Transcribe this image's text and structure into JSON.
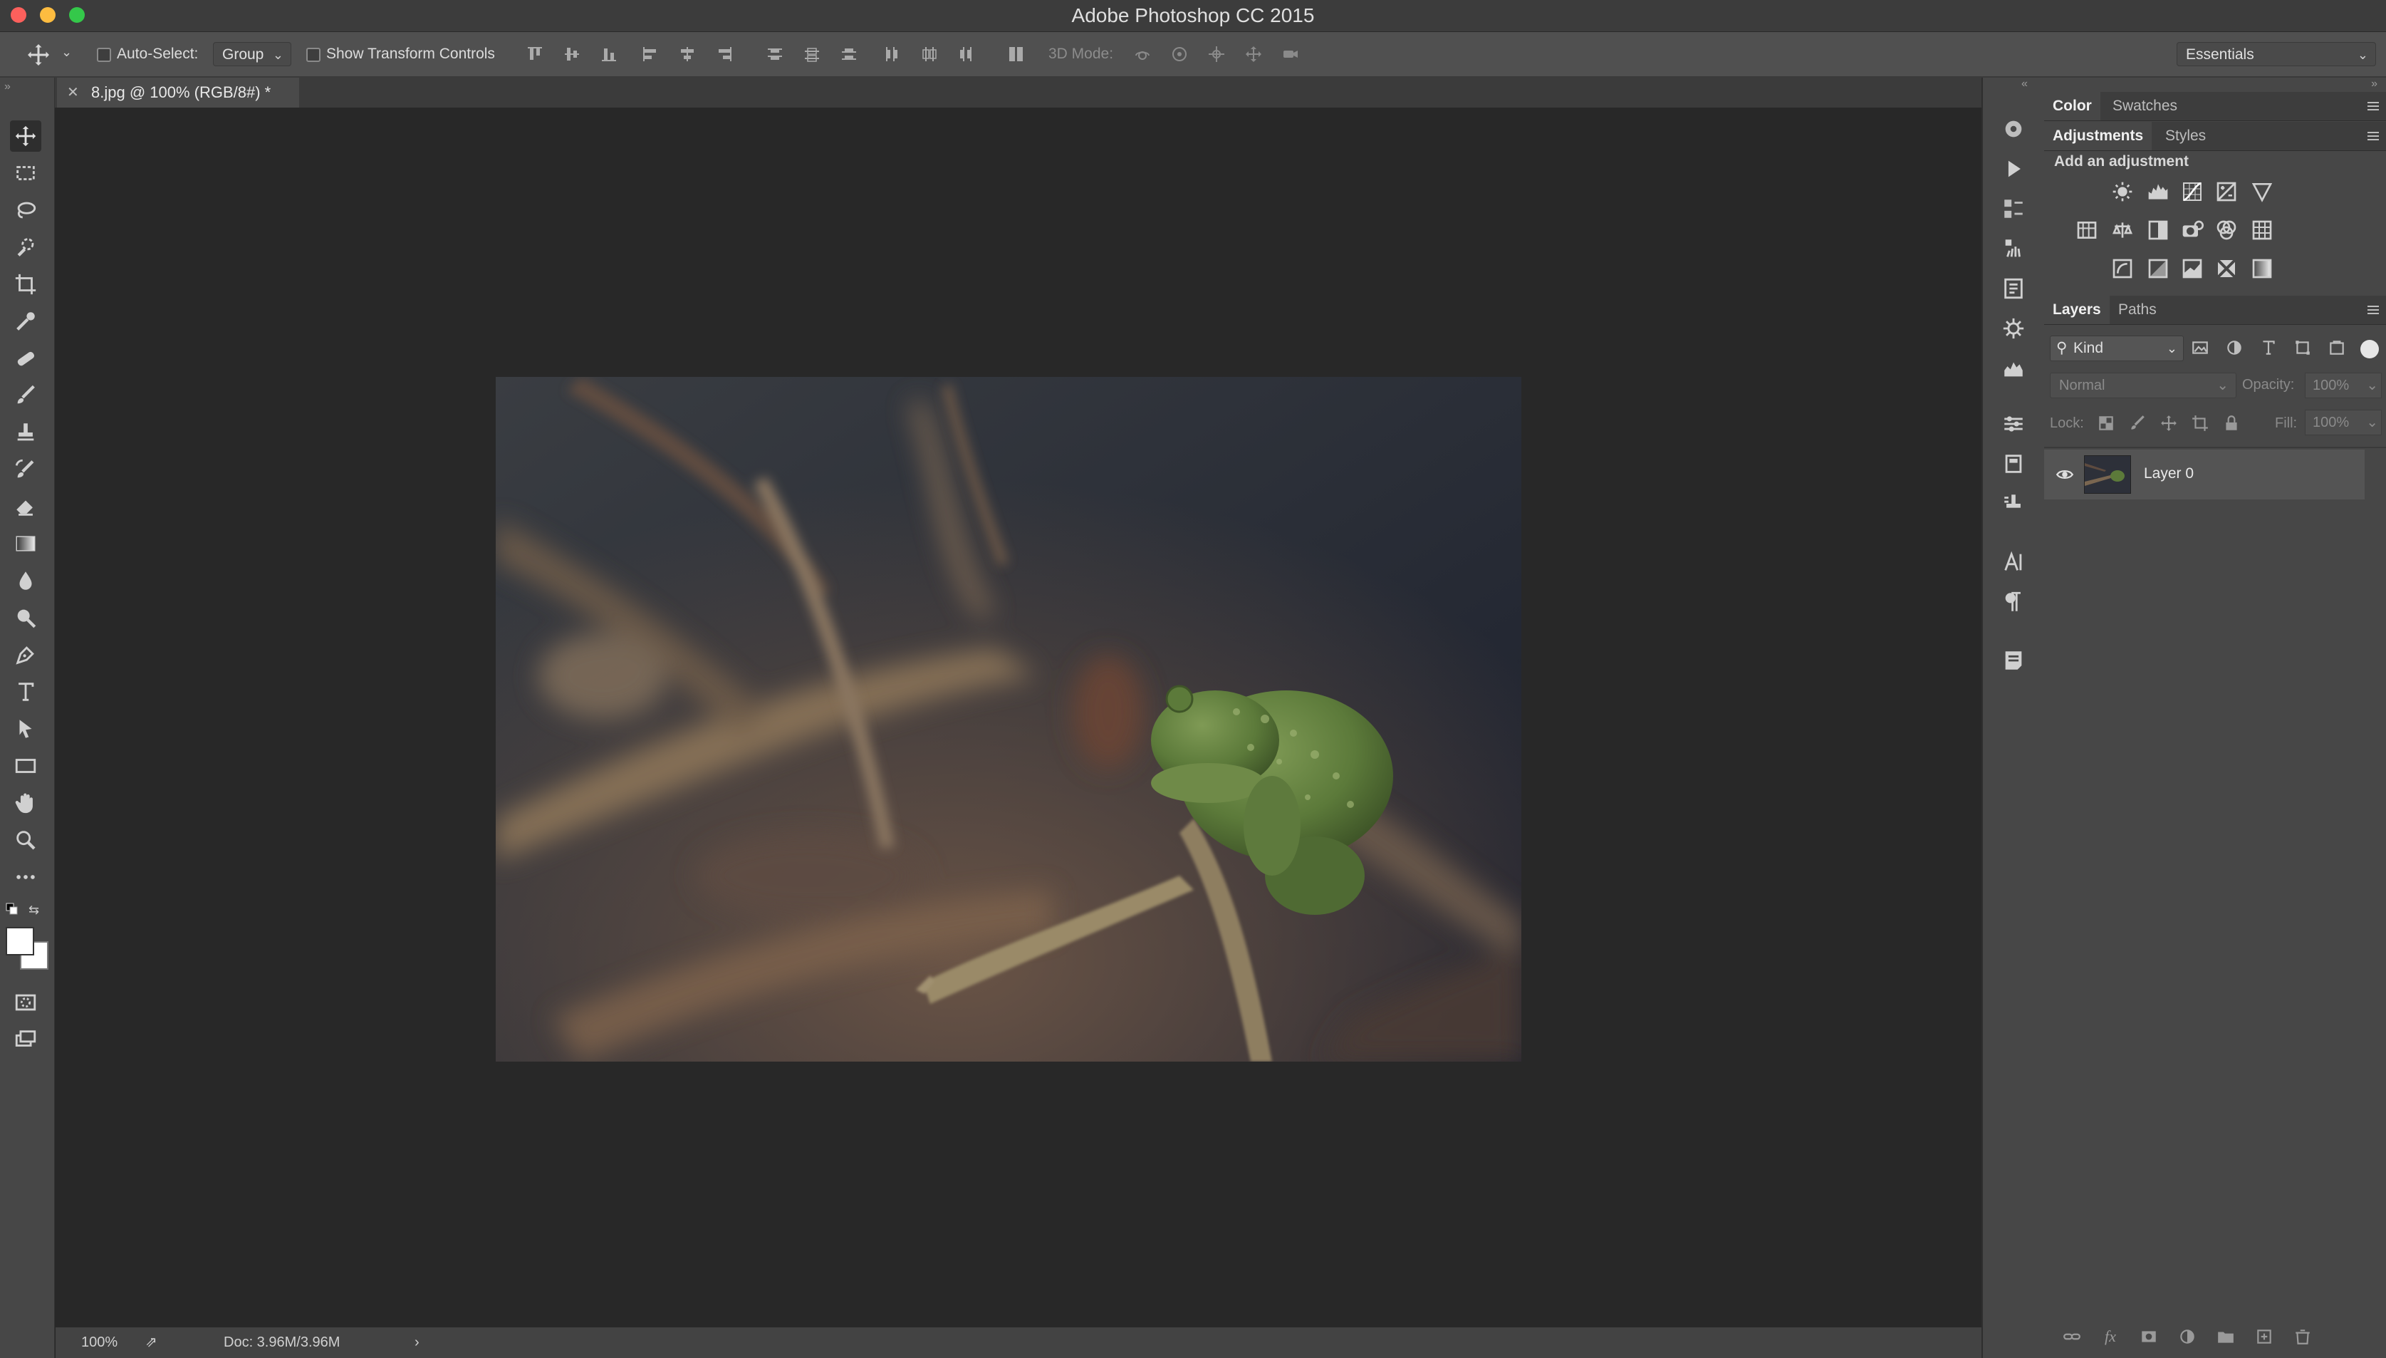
{
  "app": {
    "title": "Adobe Photoshop CC 2015"
  },
  "options_bar": {
    "auto_select_label": "Auto-Select:",
    "auto_select_value": "Group",
    "show_transform_label": "Show Transform Controls",
    "mode_3d_label": "3D Mode:",
    "workspace": "Essentials"
  },
  "document": {
    "tab_title": "8.jpg @ 100% (RGB/8#) *"
  },
  "status": {
    "zoom": "100%",
    "doc_info": "Doc: 3.96M/3.96M"
  },
  "panels": {
    "color_tabs": [
      "Color",
      "Swatches"
    ],
    "adjust_tabs": [
      "Adjustments",
      "Styles"
    ],
    "add_adjustment": "Add an adjustment",
    "layers_tabs": [
      "Layers",
      "Paths"
    ],
    "filter_kind": "Kind",
    "blend_mode": "Normal",
    "opacity_label": "Opacity:",
    "opacity_value": "100%",
    "lock_label": "Lock:",
    "fill_label": "Fill:",
    "fill_value": "100%",
    "layers": [
      {
        "name": "Layer 0",
        "visible": true
      }
    ]
  },
  "colors": {
    "accent": "#2d8ceb",
    "bg": "#282828",
    "panel": "#474747"
  }
}
